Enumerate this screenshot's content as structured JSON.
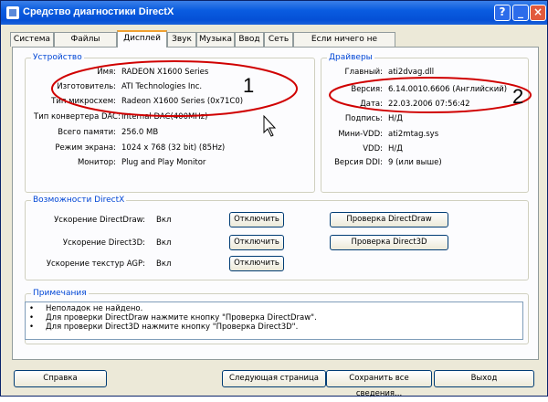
{
  "window": {
    "title": "Средство диагностики DirectX"
  },
  "tabs": [
    "Система",
    "Файлы DirectX",
    "Дисплей",
    "Звук",
    "Музыка",
    "Ввод",
    "Сеть",
    "Если ничего не помогло"
  ],
  "device": {
    "heading": "Устройство",
    "rows": [
      {
        "label": "Имя:",
        "value": "RADEON X1600 Series"
      },
      {
        "label": "Изготовитель:",
        "value": "ATI Technologies Inc."
      },
      {
        "label": "Тип микросхем:",
        "value": "Radeon X1600 Series (0x71C0)"
      },
      {
        "label": "Тип конвертера DAC:",
        "value": "Internal DAC(400MHz)"
      },
      {
        "label": "Всего памяти:",
        "value": "256.0 MB"
      },
      {
        "label": "Режим экрана:",
        "value": "1024 x 768 (32 bit) (85Hz)"
      },
      {
        "label": "Монитор:",
        "value": "Plug and Play Monitor"
      }
    ]
  },
  "drivers": {
    "heading": "Драйверы",
    "rows": [
      {
        "label": "Главный:",
        "value": "ati2dvag.dll"
      },
      {
        "label": "Версия:",
        "value": "6.14.0010.6606 (Английский)"
      },
      {
        "label": "Дата:",
        "value": "22.03.2006 07:56:42"
      },
      {
        "label": "Подпись:",
        "value": "Н/Д"
      },
      {
        "label": "Мини-VDD:",
        "value": "ati2mtag.sys"
      },
      {
        "label": "VDD:",
        "value": "Н/Д"
      },
      {
        "label": "Версия DDI:",
        "value": "9 (или выше)"
      }
    ]
  },
  "annotations": {
    "one": "1",
    "two": "2"
  },
  "features": {
    "heading": "Возможности DirectX",
    "rows": [
      {
        "label": "Ускорение DirectDraw:",
        "value": "Вкл",
        "button": "Отключить"
      },
      {
        "label": "Ускорение Direct3D:",
        "value": "Вкл",
        "button": "Отключить"
      },
      {
        "label": "Ускорение текстур AGP:",
        "value": "Вкл",
        "button": "Отключить"
      }
    ],
    "check_directdraw": "Проверка DirectDraw",
    "check_direct3d": "Проверка Direct3D"
  },
  "notes": {
    "heading": "Примечания",
    "items": [
      "Неполадок не найдено.",
      "Для проверки DirectDraw нажмите кнопку \"Проверка DirectDraw\".",
      "Для проверки Direct3D нажмите кнопку \"Проверка Direct3D\"."
    ]
  },
  "footer": {
    "help": "Справка",
    "next": "Следующая страница",
    "save": "Сохранить все сведения...",
    "exit": "Выход"
  },
  "colors": {
    "title_bar": "#0a5ce0",
    "group_label": "#0046d5",
    "annotation": "#d00000"
  }
}
